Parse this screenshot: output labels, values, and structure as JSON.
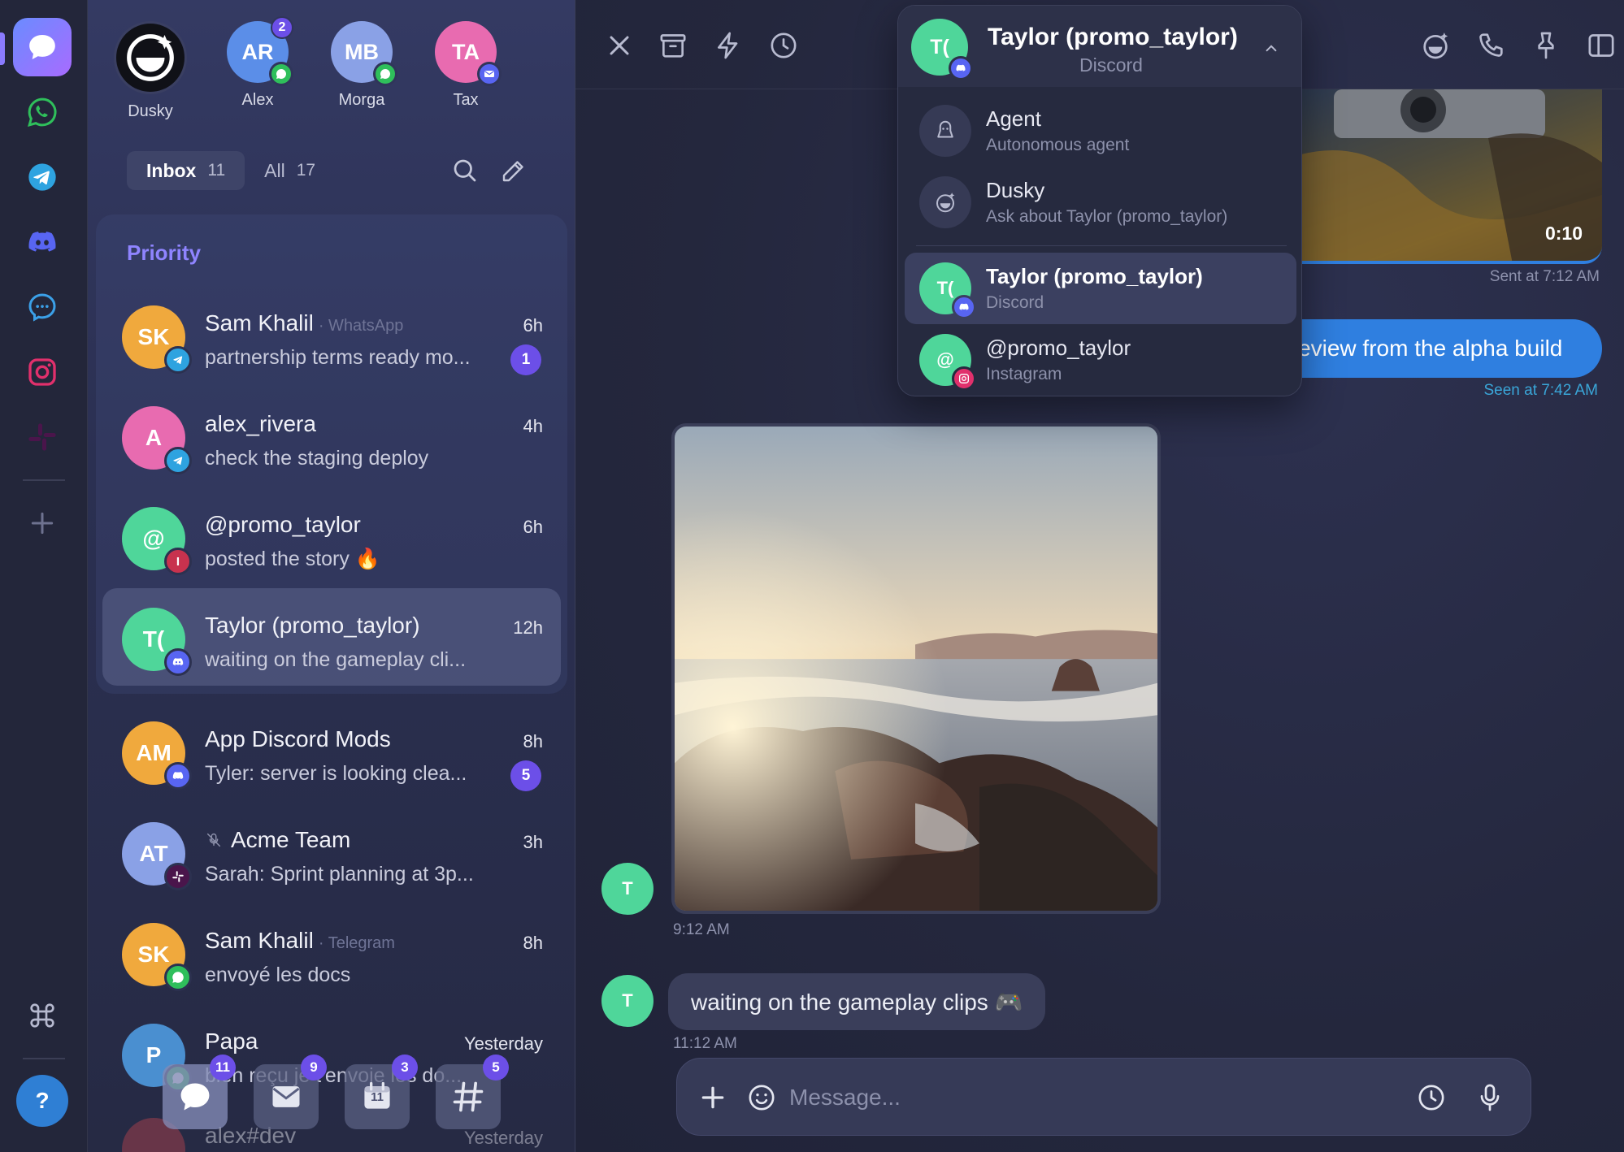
{
  "stories": [
    {
      "initials": "",
      "name": "Dusky",
      "bg": "#101117",
      "net": "",
      "badge": ""
    },
    {
      "initials": "AR",
      "name": "Alex",
      "bg": "#5b8ee8",
      "net": "whatsapp",
      "badge": "2"
    },
    {
      "initials": "MB",
      "name": "Morga",
      "bg": "#8aa1e6",
      "net": "whatsapp",
      "badge": ""
    },
    {
      "initials": "TA",
      "name": "Tax",
      "bg": "#e86bb0",
      "net": "email",
      "badge": ""
    }
  ],
  "tabs": {
    "inbox_label": "Inbox",
    "inbox_count": "11",
    "all_label": "All",
    "all_count": "17"
  },
  "priority_label": "Priority",
  "conversations": [
    {
      "initials": "SK",
      "title": "Sam Khalil",
      "source": "· WhatsApp",
      "preview": "partnership terms ready mo...",
      "time": "6h",
      "unread": "1",
      "net": "telegram",
      "bg": "#f0a93d"
    },
    {
      "initials": "A",
      "title": "alex_rivera",
      "source": "",
      "preview": "check the staging deploy",
      "time": "4h",
      "unread": "",
      "net": "telegram",
      "bg": "#e86bb0"
    },
    {
      "initials": "@",
      "title": "@promo_taylor",
      "source": "",
      "preview": "posted the story 🔥",
      "time": "6h",
      "unread": "",
      "net": "instagram",
      "bg": "#4fd69a"
    },
    {
      "initials": "T(",
      "title": "Taylor (promo_taylor)",
      "source": "",
      "preview": "waiting on the gameplay cli...",
      "time": "12h",
      "unread": "",
      "net": "discord",
      "bg": "#4fd69a"
    },
    {
      "initials": "AM",
      "title": "App Discord Mods",
      "source": "",
      "preview": "Tyler: server is looking clea...",
      "time": "8h",
      "unread": "5",
      "net": "discord",
      "bg": "#f0a93d"
    },
    {
      "initials": "AT",
      "title": "Acme Team",
      "source": "",
      "preview": "Sarah: Sprint planning at 3p...",
      "time": "3h",
      "unread": "",
      "net": "slack",
      "bg": "#8aa1e6"
    },
    {
      "initials": "SK",
      "title": "Sam Khalil",
      "source": "· Telegram",
      "preview": "envoyé les docs",
      "time": "8h",
      "unread": "",
      "net": "whatsapp",
      "bg": "#f0a93d"
    },
    {
      "initials": "P",
      "title": "Papa",
      "source": "",
      "preview": "bien reçu je t'envoie les do...",
      "time": "Yesterday",
      "unread": "",
      "net": "whatsapp",
      "bg": "#4a8fd0"
    },
    {
      "initials": "",
      "title": "alex#dev",
      "source": "",
      "preview": "",
      "time": "Yesterday",
      "unread": "",
      "net": "",
      "bg": "#b9434f"
    }
  ],
  "dock": [
    {
      "icon": "chat",
      "badge": "11"
    },
    {
      "icon": "mail",
      "badge": "9"
    },
    {
      "icon": "calendar",
      "badge": "3",
      "day": "11"
    },
    {
      "icon": "hash",
      "badge": "5"
    }
  ],
  "chat": {
    "video_duration": "0:10",
    "sent_at": "Sent at 7:12 AM",
    "outgoing_text": "heres a preview from the alpha build",
    "seen_at": "Seen at 7:42 AM",
    "sender_initial": "T",
    "photo_time": "9:12 AM",
    "incoming_text": "waiting on the gameplay clips 🎮",
    "incoming_time": "11:12 AM",
    "composer_placeholder": "Message..."
  },
  "dropdown": {
    "title": "Taylor (promo_taylor)",
    "subtitle": "Discord",
    "avatar_initials": "T(",
    "items": [
      {
        "title": "Agent",
        "sub": "Autonomous agent",
        "icon": "agent"
      },
      {
        "title": "Dusky",
        "sub": "Ask about Taylor (promo_taylor)",
        "icon": "dusky"
      },
      {
        "title": "Taylor (promo_taylor)",
        "sub": "Discord",
        "icon": "avatar",
        "initials": "T(",
        "net": "discord"
      },
      {
        "title": "@promo_taylor",
        "sub": "Instagram",
        "icon": "avatar",
        "initials": "@",
        "net": "instagram"
      }
    ]
  },
  "colors": {
    "accent": "#6c4fe8",
    "whatsapp": "#2fbf5b",
    "telegram": "#2ea3e0",
    "discord": "#5865f2",
    "instagram": "#e1306c",
    "slack": "#4a154b",
    "email": "#5865f2",
    "outgoing": "#2f7fe0"
  }
}
